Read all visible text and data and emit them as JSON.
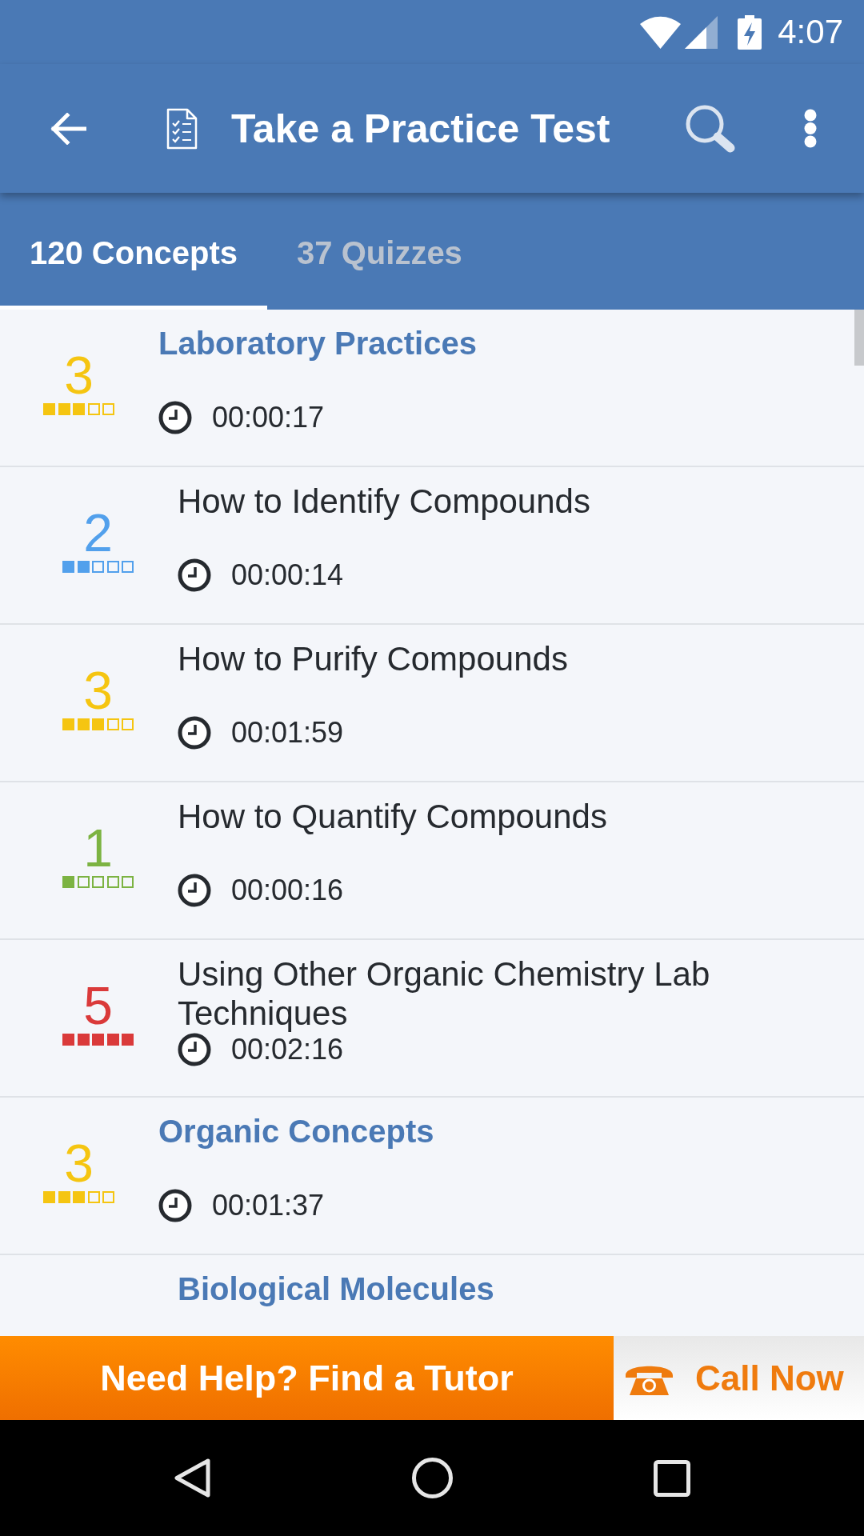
{
  "status_bar": {
    "time": "4:07"
  },
  "app_bar": {
    "title": "Take a Practice Test"
  },
  "tabs": [
    {
      "label": "120 Concepts",
      "selected": true
    },
    {
      "label": "37 Quizzes",
      "selected": false
    }
  ],
  "concepts": [
    {
      "kind": "category",
      "title": "Laboratory Practices",
      "score": "3",
      "stars": 3,
      "color": "#f5c511",
      "time": "00:00:17",
      "children": [
        {
          "kind": "concept",
          "title": "How to Identify Compounds",
          "score": "2",
          "stars": 2,
          "color": "#52a0ec",
          "time": "00:00:14"
        },
        {
          "kind": "concept",
          "title": "How to Purify Compounds",
          "score": "3",
          "stars": 3,
          "color": "#f5c511",
          "time": "00:01:59"
        },
        {
          "kind": "concept",
          "title": "How to Quantify Compounds",
          "score": "1",
          "stars": 1,
          "color": "#7cb342",
          "time": "00:00:16"
        },
        {
          "kind": "concept",
          "title": "Using Other Organic Chemistry Lab Techniques",
          "score": "5",
          "stars": 5,
          "color": "#da3a3a",
          "time": "00:02:16"
        }
      ]
    },
    {
      "kind": "category",
      "title": "Organic Concepts",
      "score": "3",
      "stars": 3,
      "color": "#f5c511",
      "time": "00:01:37",
      "children": [
        {
          "kind": "category",
          "title": "Biological Molecules"
        }
      ]
    }
  ],
  "help_banner": {
    "text": "Need Help? Find a Tutor"
  },
  "call_button": {
    "label": "Call Now"
  }
}
